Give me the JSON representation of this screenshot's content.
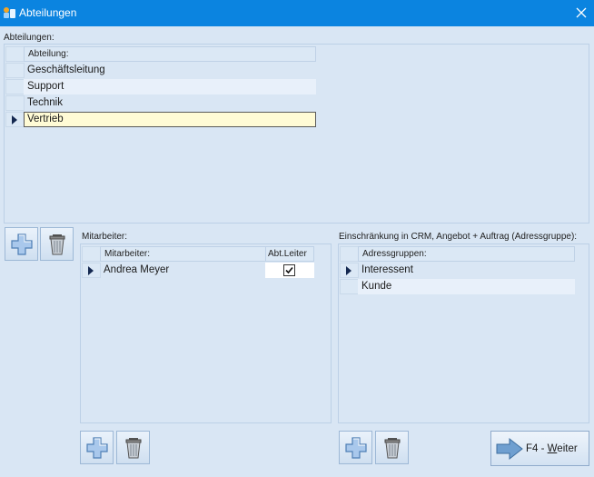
{
  "window": {
    "title": "Abteilungen",
    "accent": "#0b84e0"
  },
  "departments": {
    "section_label": "Abteilungen:",
    "column_header": "Abteilung:",
    "rows": [
      "Geschäftsleitung",
      "Support",
      "Technik",
      "Vertrieb"
    ],
    "selected": "Vertrieb"
  },
  "employees": {
    "section_label": "Mitarbeiter:",
    "columns": [
      "Mitarbeiter:",
      "Abt.Leiter"
    ],
    "rows": [
      {
        "name": "Andrea Meyer",
        "leader": true
      }
    ]
  },
  "restriction": {
    "section_label": "Einschränkung in CRM, Angebot + Auftrag (Adressgruppe):",
    "column_header": "Adressgruppen:",
    "rows": [
      "Interessent",
      "Kunde"
    ]
  },
  "footer": {
    "next_prefix": "F4 - ",
    "next_key": "W",
    "next_rest": "eiter"
  },
  "icons": {
    "add": "plus-icon",
    "delete": "trash-icon",
    "next": "arrow-right-icon",
    "close": "close-icon"
  }
}
